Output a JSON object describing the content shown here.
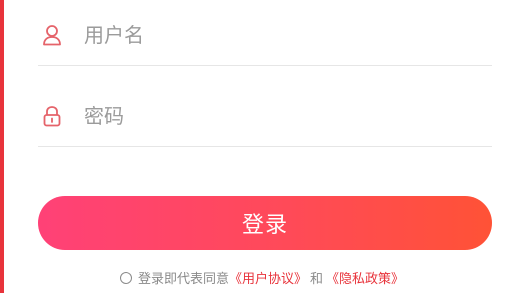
{
  "username_field": {
    "placeholder": "用户名",
    "icon": "user-icon"
  },
  "password_field": {
    "placeholder": "密码",
    "icon": "lock-icon"
  },
  "login_button": {
    "label": "登录"
  },
  "agreement": {
    "prefix": "登录即代表同意",
    "user_agreement": "《用户协议》",
    "and": "和",
    "privacy_policy": "《隐私政策》"
  },
  "colors": {
    "accent": "#e8333b",
    "button_start": "#ff4177",
    "button_end": "#ff5236"
  }
}
